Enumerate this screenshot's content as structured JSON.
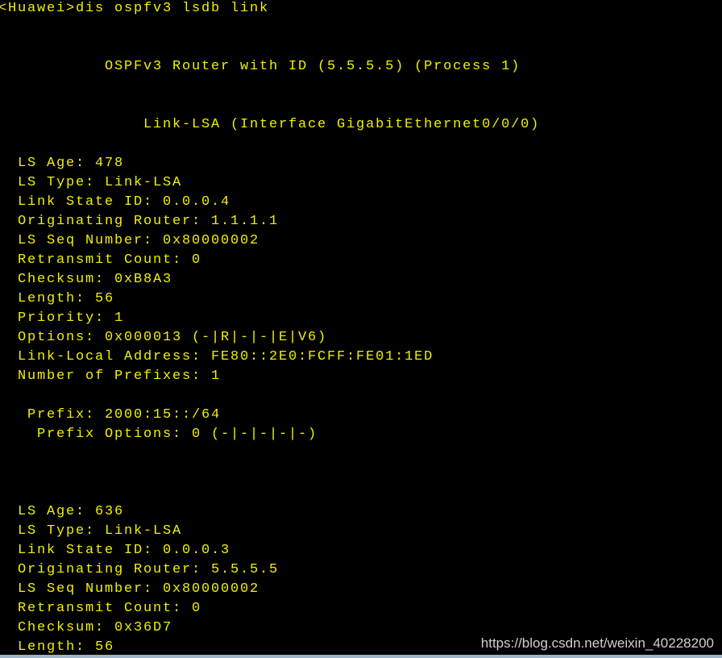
{
  "terminal": {
    "lines": [
      "<Huawei>dis ospfv3 lsdb link",
      "",
      "",
      "           OSPFv3 Router with ID (5.5.5.5) (Process 1)",
      "",
      "",
      "               Link-LSA (Interface GigabitEthernet0/0/0)",
      "",
      "  LS Age: 478",
      "  LS Type: Link-LSA",
      "  Link State ID: 0.0.0.4",
      "  Originating Router: 1.1.1.1",
      "  LS Seq Number: 0x80000002",
      "  Retransmit Count: 0",
      "  Checksum: 0xB8A3",
      "  Length: 56",
      "  Priority: 1",
      "  Options: 0x000013 (-|R|-|-|E|V6)",
      "  Link-Local Address: FE80::2E0:FCFF:FE01:1ED",
      "  Number of Prefixes: 1",
      "",
      "   Prefix: 2000:15::/64",
      "    Prefix Options: 0 (-|-|-|-|-)",
      "",
      "",
      "",
      "  LS Age: 636",
      "  LS Type: Link-LSA",
      "  Link State ID: 0.0.0.3",
      "  Originating Router: 5.5.5.5",
      "  LS Seq Number: 0x80000002",
      "  Retransmit Count: 0",
      "  Checksum: 0x36D7",
      "  Length: 56"
    ]
  },
  "watermark": "https://blog.csdn.net/weixin_40228200",
  "colors": {
    "background": "#000000",
    "text": "#f0f000"
  }
}
